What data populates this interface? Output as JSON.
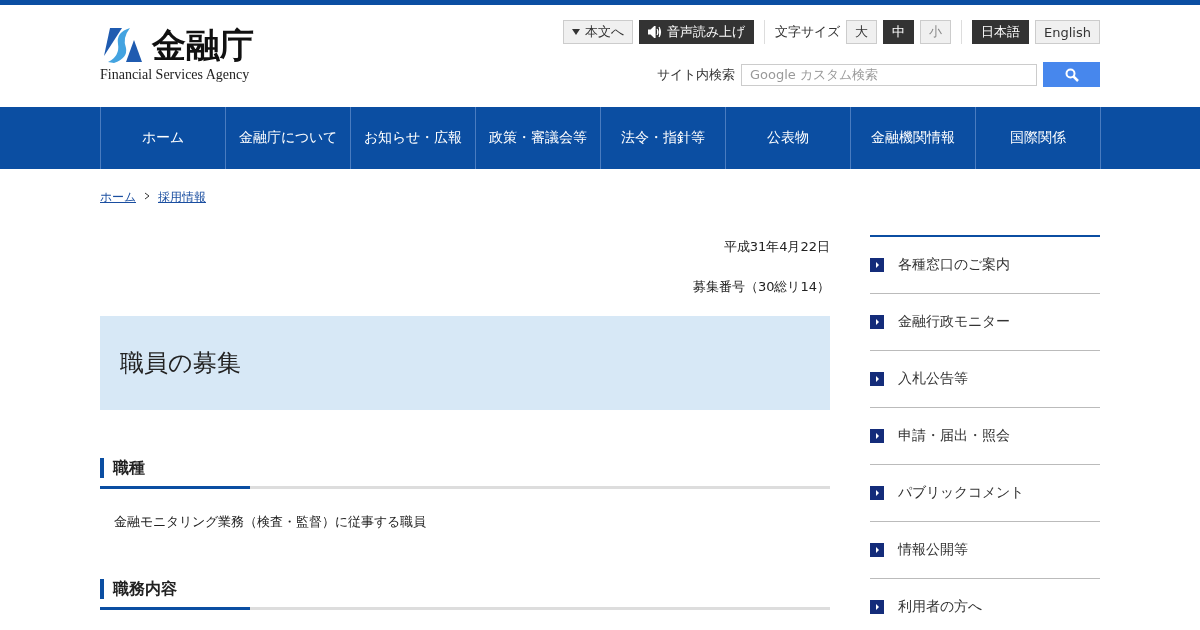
{
  "logo": {
    "title": "金融庁",
    "subtitle": "Financial Services Agency"
  },
  "utility": {
    "skip_link": "本文へ",
    "read_aloud": "音声読み上げ",
    "font_size_label": "文字サイズ",
    "font_sizes": [
      {
        "label": "大",
        "selected": false
      },
      {
        "label": "中",
        "selected": true
      },
      {
        "label": "小",
        "selected": false
      }
    ],
    "languages": [
      {
        "label": "日本語",
        "selected": true
      },
      {
        "label": "English",
        "selected": false
      }
    ],
    "search_label": "サイト内検索",
    "search_placeholder": "Google カスタム検索"
  },
  "nav": [
    "ホーム",
    "金融庁について",
    "お知らせ・広報",
    "政策・審議会等",
    "法令・指針等",
    "公表物",
    "金融機関情報",
    "国際関係"
  ],
  "breadcrumb": [
    "ホーム",
    "採用情報"
  ],
  "date": "平成31年4月22日",
  "recruit_no": "募集番号（30総リ14）",
  "page_title": "職員の募集",
  "sections": [
    {
      "heading": "職種",
      "body": "金融モニタリング業務（検査・監督）に従事する職員"
    },
    {
      "heading": "職務内容"
    }
  ],
  "sidebar": [
    "各種窓口のご案内",
    "金融行政モニター",
    "入札公告等",
    "申請・届出・照会",
    "パブリックコメント",
    "情報公開等",
    "利用者の方へ"
  ]
}
